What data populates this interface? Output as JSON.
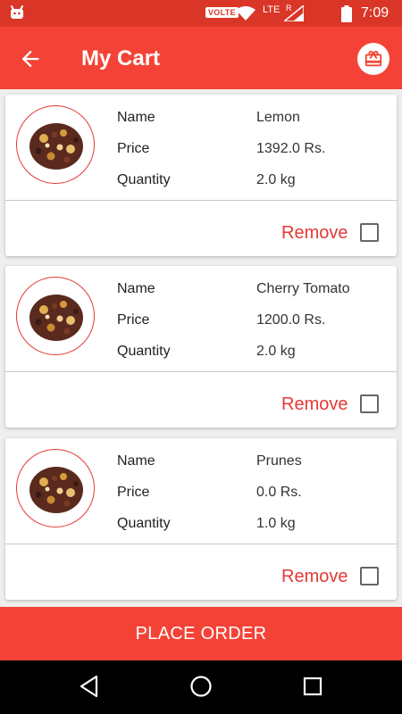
{
  "status_bar": {
    "network_badge": "VOLTE",
    "network_type": "LTE",
    "roaming": "R",
    "time": "7:09"
  },
  "app_bar": {
    "title": "My Cart",
    "back_icon": "arrow-back-icon",
    "gift_icon": "gift-icon"
  },
  "cart": {
    "items": [
      {
        "name_label": "Name",
        "name": "Lemon",
        "price_label": "Price",
        "price": "1392.0 Rs.",
        "quantity_label": "Quantity",
        "quantity": "2.0 kg",
        "remove_label": "Remove",
        "selected": false
      },
      {
        "name_label": "Name",
        "name": "Cherry Tomato",
        "price_label": "Price",
        "price": "1200.0 Rs.",
        "quantity_label": "Quantity",
        "quantity": "2.0 kg",
        "remove_label": "Remove",
        "selected": false
      },
      {
        "name_label": "Name",
        "name": "Prunes",
        "price_label": "Price",
        "price": "0.0 Rs.",
        "quantity_label": "Quantity",
        "quantity": "1.0 kg",
        "remove_label": "Remove",
        "selected": false
      }
    ]
  },
  "footer": {
    "place_order_label": "PLACE ORDER"
  },
  "colors": {
    "primary": "#f44336",
    "status_bar": "#d93628",
    "accent_text": "#e53935"
  }
}
